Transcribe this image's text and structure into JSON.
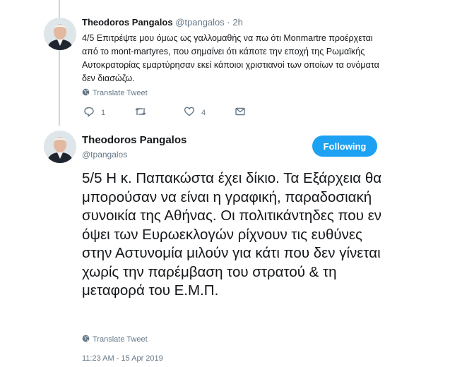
{
  "tweet1": {
    "author_name": "Theodoros Pangalos",
    "handle": "@tpangalos",
    "separator": "·",
    "time": "2h",
    "text": "4/5 Επιτρέψτε μου όμως ως γαλλομαθής να πω ότι Monmartre προέρχεται από το mont-martyres, που σημαίνει ότι κάποτε την εποχή της Ρωμαϊκής Αυτοκρατορίας εμαρτύρησαν εκεί κάποιοι χριστιανοί των οποίων τα ονόματα δεν διασώζω.",
    "translate_label": "Translate Tweet",
    "actions": {
      "reply_count": "1",
      "retweet_count": "",
      "like_count": "4"
    }
  },
  "tweet2": {
    "author_name": "Theodoros Pangalos",
    "handle": "@tpangalos",
    "follow_label": "Following",
    "text": "5/5 Η κ. Παπακώστα έχει δίκιο. Τα Εξάρχεια θα μπορούσαν να είναι η γραφική, παραδοσιακή συνοικία της Αθήνας. Οι πολιτικάντηδες που εν όψει των Ευρωεκλογών ρίχνουν τις ευθύνες στην Αστυνομία μιλούν για κάτι που δεν γίνεται χωρίς την παρέμβαση του στρατού & τη μεταφορά του Ε.Μ.Π.",
    "translate_label": "Translate Tweet",
    "timestamp": "11:23 AM - 15 Apr 2019"
  },
  "colors": {
    "accent": "#1da1f2",
    "muted": "#657786",
    "text": "#14171a",
    "thread_line": "#ccd6dd"
  },
  "icons": [
    "globe-icon",
    "reply-icon",
    "retweet-icon",
    "like-icon",
    "message-icon"
  ]
}
